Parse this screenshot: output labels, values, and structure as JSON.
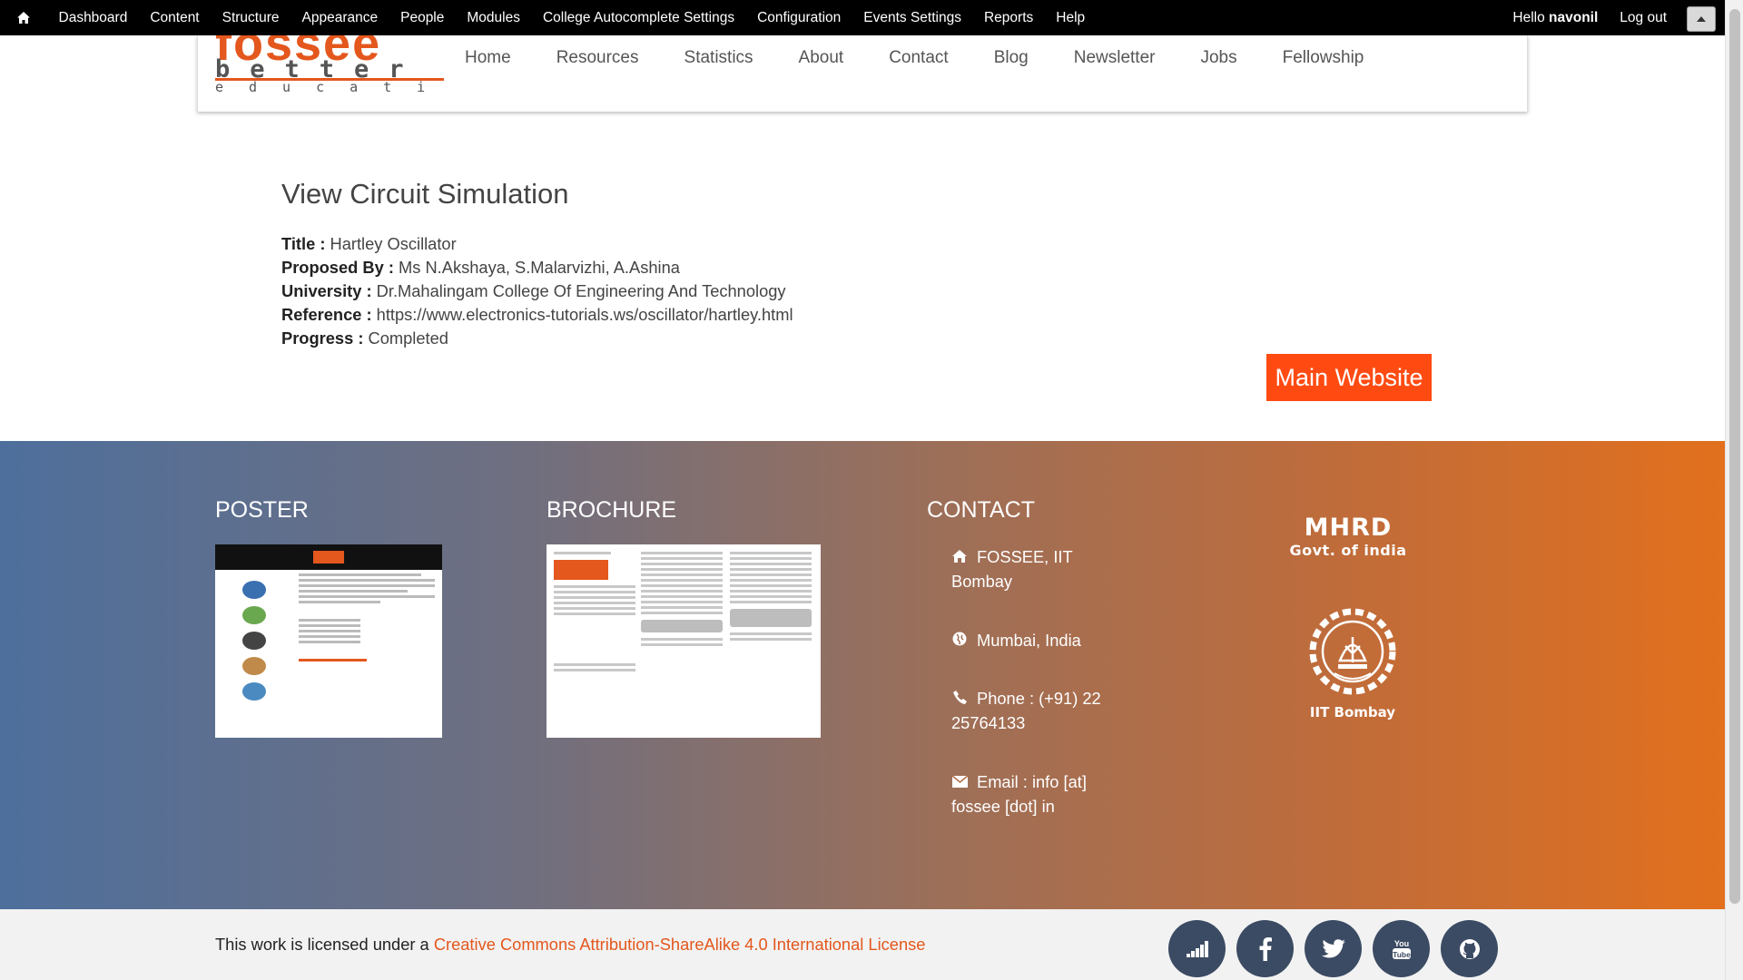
{
  "admin_toolbar": {
    "items": [
      "Dashboard",
      "Content",
      "Structure",
      "Appearance",
      "People",
      "Modules",
      "College Autocomplete Settings",
      "Configuration",
      "Events Settings",
      "Reports",
      "Help"
    ],
    "hello_prefix": "Hello ",
    "username": "navonil",
    "logout": "Log out",
    "icons": [
      "home-icon",
      "triangle-up-icon"
    ]
  },
  "site_header": {
    "logo_text": {
      "line1": "fossee",
      "line2": "better",
      "line3": "education"
    },
    "nav": [
      "Home",
      "Resources",
      "Statistics",
      "About",
      "Contact",
      "Blog",
      "Newsletter",
      "Jobs",
      "Fellowship"
    ]
  },
  "main": {
    "title": "View Circuit Simulation",
    "fields": [
      {
        "label": "Title :",
        "value": "Hartley Oscillator"
      },
      {
        "label": "Proposed By :",
        "value": "Ms N.Akshaya, S.Malarvizhi, A.Ashina"
      },
      {
        "label": "University :",
        "value": "Dr.Mahalingam College Of Engineering And Technology"
      },
      {
        "label": "Reference :",
        "value": "https://www.electronics-tutorials.ws/oscillator/hartley.html"
      },
      {
        "label": "Progress :",
        "value": "Completed"
      }
    ],
    "main_website_button": "Main Website"
  },
  "footer": {
    "poster_heading": "POSTER",
    "brochure_heading": "BROCHURE",
    "contact_heading": "CONTACT",
    "contact": {
      "address": "FOSSEE, IIT Bombay",
      "city": "Mumbai, India",
      "phone": "Phone : (+91) 22 25764133",
      "email": "Email : info [at] fossee [dot] in"
    },
    "mhrd_line1": "MHRD",
    "mhrd_line2": "Govt. of india",
    "iitb": "IIT Bombay",
    "gradient": [
      "#4e6f9c",
      "#e2701d"
    ]
  },
  "bottom": {
    "license_prefix": "This work is licensed under a ",
    "license_link": "Creative Commons Attribution-ShareAlike 4.0 International License",
    "social_icons": [
      "stats-icon",
      "facebook-icon",
      "twitter-icon",
      "youtube-icon",
      "github-icon"
    ]
  },
  "colors": {
    "accent": "#ff4b12",
    "admin_bar": "#000000",
    "social_bg": "#3b4b63"
  }
}
